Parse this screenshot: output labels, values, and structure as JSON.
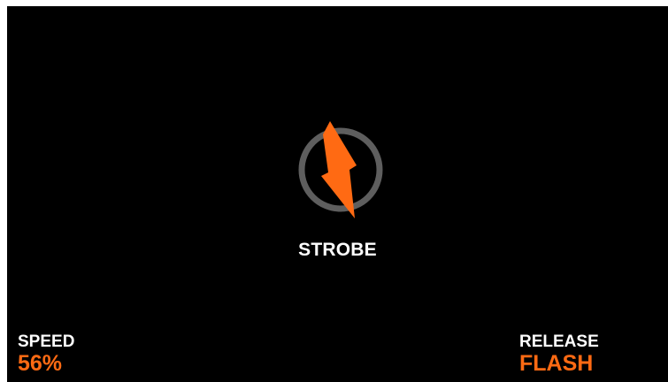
{
  "mode": {
    "icon": "lightning-bolt-icon",
    "label": "STROBE"
  },
  "parameters": {
    "left": {
      "label": "SPEED",
      "value": "56%"
    },
    "right": {
      "label": "RELEASE",
      "value": "FLASH"
    }
  },
  "colors": {
    "background": "#000000",
    "accent": "#ff6a13",
    "ring": "#5e5e5e",
    "text": "#ffffff"
  }
}
